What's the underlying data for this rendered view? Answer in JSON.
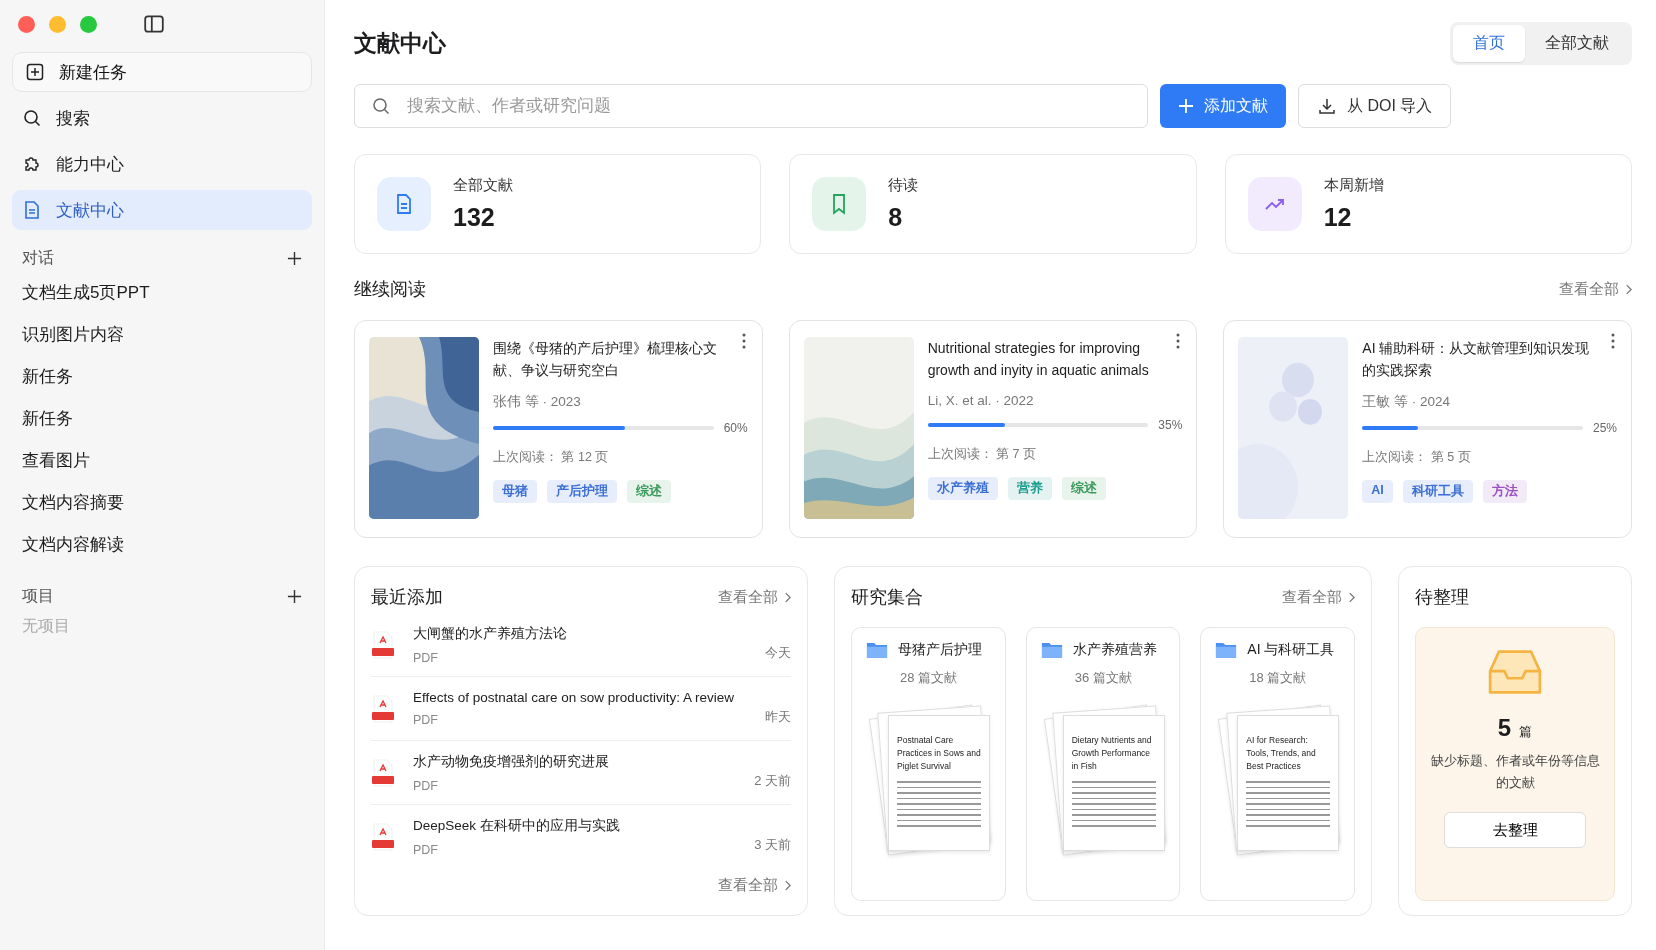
{
  "sidebar": {
    "new_task": "新建任务",
    "nav": [
      {
        "label": "搜索",
        "selected": false
      },
      {
        "label": "能力中心",
        "selected": false
      },
      {
        "label": "文献中心",
        "selected": true
      }
    ],
    "conversations": {
      "title": "对话",
      "items": [
        "文档生成5页PPT",
        "识别图片内容",
        "新任务",
        "新任务",
        "查看图片",
        "文档内容摘要",
        "文档内容解读"
      ]
    },
    "projects": {
      "title": "项目",
      "empty": "无项目"
    }
  },
  "header": {
    "title": "文献中心",
    "tabs": [
      {
        "label": "首页",
        "selected": true
      },
      {
        "label": "全部文献",
        "selected": false
      }
    ]
  },
  "search": {
    "placeholder": "搜索文献、作者或研究问题"
  },
  "actions": {
    "add": "添加文献",
    "import": "从 DOI 导入"
  },
  "stats": [
    {
      "label": "全部文献",
      "value": "132",
      "color": "#2f7bf5"
    },
    {
      "label": "待读",
      "value": "8",
      "color": "#22a559"
    },
    {
      "label": "本周新增",
      "value": "12",
      "color": "#8a5cf0"
    }
  ],
  "continue_reading": {
    "title": "继续阅读",
    "view_all": "查看全部",
    "items": [
      {
        "title": "围绕《母猪的产后护理》梳理核心文献、争议与研究空白",
        "meta": "张伟 等 · 2023",
        "level": 0.6,
        "percent": "60%",
        "last_read": "上次阅读：  第 12 页",
        "tags": [
          {
            "label": "母猪",
            "color": "#3b6fd4"
          },
          {
            "label": "产后护理",
            "color": "#3b6fd4"
          },
          {
            "label": "综述",
            "color": "#3a9a5b"
          }
        ]
      },
      {
        "title": "Nutritional strategies for improving growth and inyity in aquatic animals",
        "meta": "Li, X. et al. · 2022",
        "level": 0.35,
        "percent": "35%",
        "last_read": "上次阅读：  第 7 页",
        "tags": [
          {
            "label": "水产养殖",
            "color": "#3b6fd4"
          },
          {
            "label": "营养",
            "color": "#1f9e8f"
          },
          {
            "label": "综述",
            "color": "#3a9a5b"
          }
        ]
      },
      {
        "title": "AI 辅助科研：从文献管理到知识发现的实践探索",
        "meta": "王敏 等 · 2024",
        "level": 0.25,
        "percent": "25%",
        "last_read": "上次阅读：  第 5 页",
        "tags": [
          {
            "label": "AI",
            "color": "#3b6fd4"
          },
          {
            "label": "科研工具",
            "color": "#3b6fd4"
          },
          {
            "label": "方法",
            "color": "#9b4fc2"
          }
        ]
      }
    ]
  },
  "recent": {
    "title": "最近添加",
    "view_all": "查看全部",
    "footer_link": "查看全部",
    "items": [
      {
        "title": "大闸蟹的水产养殖方法论",
        "type": "PDF",
        "time": "今天"
      },
      {
        "title": "Effects of postnatal care on sow productivity: A review",
        "type": "PDF",
        "time": "昨天"
      },
      {
        "title": "水产动物免疫增强剂的研究进展",
        "type": "PDF",
        "time": "2 天前"
      },
      {
        "title": "DeepSeek 在科研中的应用与实践",
        "type": "PDF",
        "time": "3 天前"
      }
    ]
  },
  "collections": {
    "title": "研究集合",
    "view_all": "查看全部",
    "items": [
      {
        "name": "母猪产后护理",
        "count": "28 篇文献",
        "cover_title": "Postnatal Care Practices in Sows and Piglet Survival"
      },
      {
        "name": "水产养殖营养",
        "count": "36 篇文献",
        "cover_title": "Dietary Nutrients and Growth Performance in Fish"
      },
      {
        "name": "AI 与科研工具",
        "count": "18 篇文献",
        "cover_title": "AI for Research: Tools, Trends, and Best Practices"
      }
    ]
  },
  "to_organize": {
    "title": "待整理",
    "count": "5",
    "unit": "篇",
    "description": "缺少标题、作者或年份等信息的文献",
    "button": "去整理"
  }
}
